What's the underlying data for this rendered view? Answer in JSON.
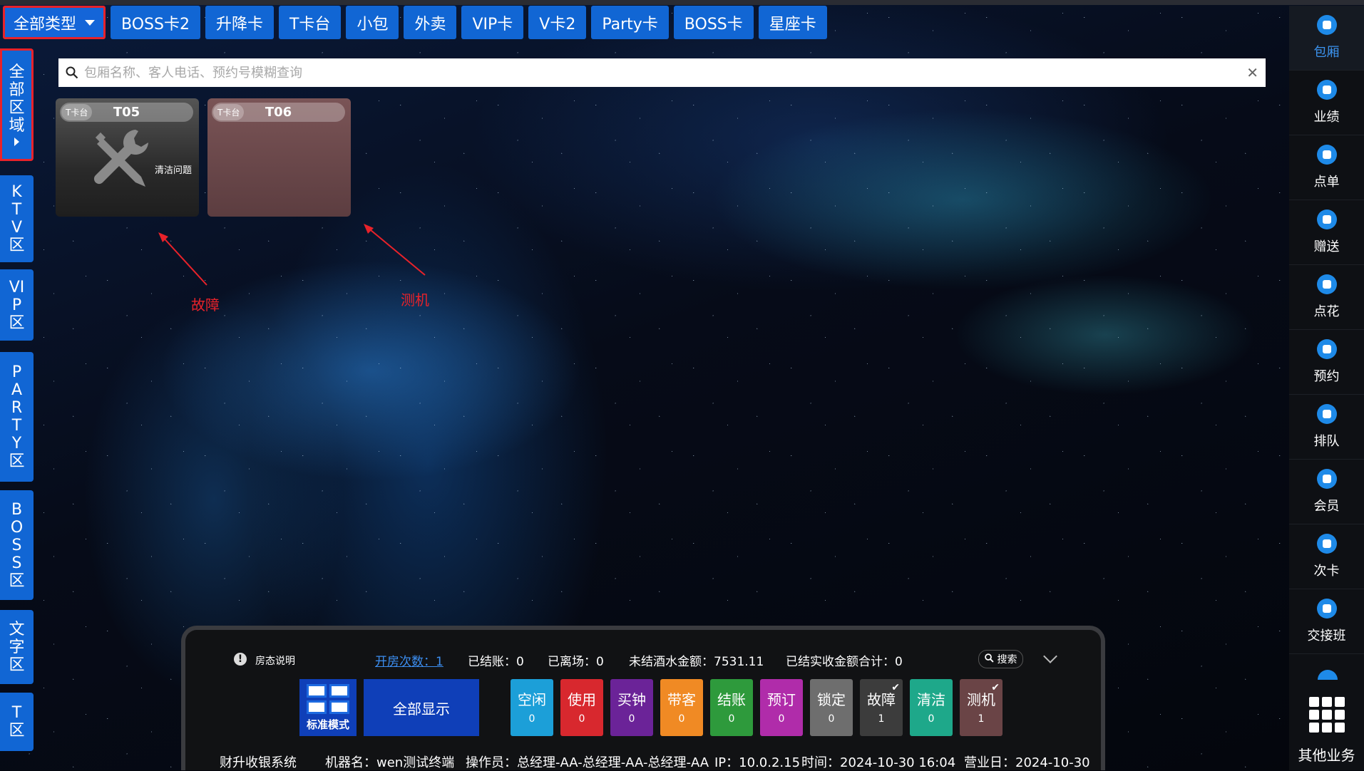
{
  "type_tabs": [
    "全部类型",
    "BOSS卡2",
    "升降卡",
    "T卡台",
    "小包",
    "外卖",
    "VIP卡",
    "V卡2",
    "Party卡",
    "BOSS卡",
    "星座卡"
  ],
  "zones": {
    "all": "全部区域",
    "ktv": "KTV区",
    "vip": "VIP区",
    "party": "PARTY区",
    "boss": "BOSS区",
    "text": "文字区",
    "t": "T区"
  },
  "search": {
    "placeholder": "包厢名称、客人电话、预约号模糊查询",
    "value": ""
  },
  "rooms": [
    {
      "type": "T卡台",
      "name": "T05",
      "status_text": "清洁问题",
      "icon": "wrench-screwdriver-icon"
    },
    {
      "type": "T卡台",
      "name": "T06",
      "status_text": ""
    }
  ],
  "annotations": {
    "fault": "故障",
    "test": "测机"
  },
  "right_menu": [
    "包厢",
    "业绩",
    "点单",
    "赠送",
    "点花",
    "预约",
    "排队",
    "会员",
    "次卡",
    "交接班"
  ],
  "other_business": "其他业务",
  "panel": {
    "room_legend": "房态说明",
    "open_count": "开房次数：1",
    "settled": "已结账：0",
    "left": "已离场：0",
    "unsettled_amount": "未结酒水金额：7531.11",
    "settled_total": "已结实收金额合计：0",
    "search_label": "搜索",
    "mode_label": "标准模式",
    "show_all": "全部显示",
    "statuses": [
      {
        "name": "空闲",
        "count": "0",
        "color": "#1c9fd8"
      },
      {
        "name": "使用",
        "count": "0",
        "color": "#d8282e"
      },
      {
        "name": "买钟",
        "count": "0",
        "color": "#6b2398"
      },
      {
        "name": "带客",
        "count": "0",
        "color": "#f08a24"
      },
      {
        "name": "结账",
        "count": "0",
        "color": "#2e9a3c"
      },
      {
        "name": "预订",
        "count": "0",
        "color": "#b02caa"
      },
      {
        "name": "锁定",
        "count": "0",
        "color": "#6e6e6e"
      },
      {
        "name": "故障",
        "count": "1",
        "color": "#3c3c3c"
      },
      {
        "name": "清洁",
        "count": "0",
        "color": "#1ea88a"
      },
      {
        "name": "测机",
        "count": "1",
        "color": "#6a4446"
      }
    ],
    "system_name": "财升收银系统",
    "machine": "机器名：wen测试终端",
    "operator": "操作员：总经理-AA-总经理-AA-总经理-AA",
    "ip": "IP：10.0.2.15",
    "time": "时间：2024-10-30 16:04",
    "business_day": "营业日：2024-10-30"
  },
  "colors": {
    "accent": "#1166d4",
    "highlight_border": "#e8222a",
    "sidebar_active": "#3c93ee"
  }
}
